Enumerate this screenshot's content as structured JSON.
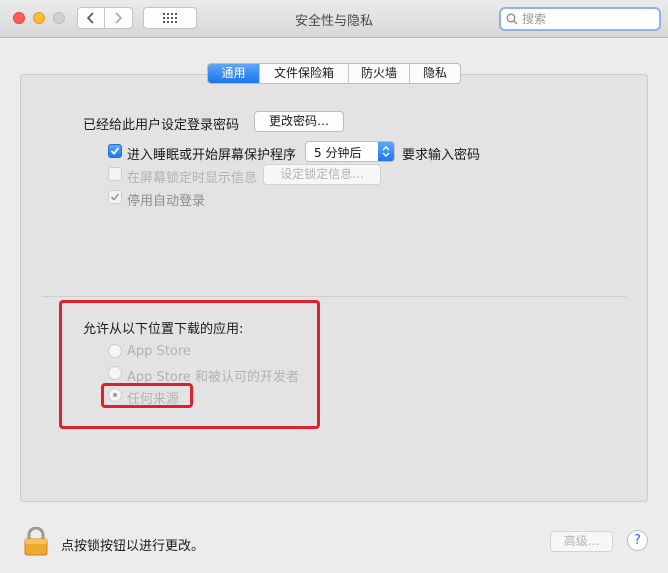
{
  "window": {
    "title": "安全性与隐私"
  },
  "search": {
    "placeholder": "搜索"
  },
  "tabs": [
    {
      "label": "通用",
      "active": true
    },
    {
      "label": "文件保险箱",
      "active": false
    },
    {
      "label": "防火墙",
      "active": false
    },
    {
      "label": "隐私",
      "active": false
    }
  ],
  "general": {
    "password_label": "已经给此用户设定登录密码",
    "change_password_button": "更改密码…",
    "require_password": {
      "label": "进入睡眠或开始屏幕保护程序",
      "checked": true,
      "delay_value": "5 分钟后",
      "suffix": "要求输入密码"
    },
    "show_message": {
      "label": "在屏幕锁定时显示信息",
      "checked": false,
      "enabled": false,
      "button": "设定锁定信息..."
    },
    "disable_auto_login": {
      "label": "停用自动登录",
      "checked": true,
      "enabled": false
    }
  },
  "downloads": {
    "heading": "允许从以下位置下载的应用:",
    "options": [
      {
        "label": "App Store",
        "selected": false
      },
      {
        "label": "App Store 和被认可的开发者",
        "selected": false
      },
      {
        "label": "任何来源",
        "selected": true
      }
    ]
  },
  "footer": {
    "lock_text": "点按锁按钮以进行更改。",
    "advanced_button": "高级...",
    "help_button": "?"
  },
  "colors": {
    "accent": "#1d76ee",
    "highlight": "#e0202c"
  }
}
